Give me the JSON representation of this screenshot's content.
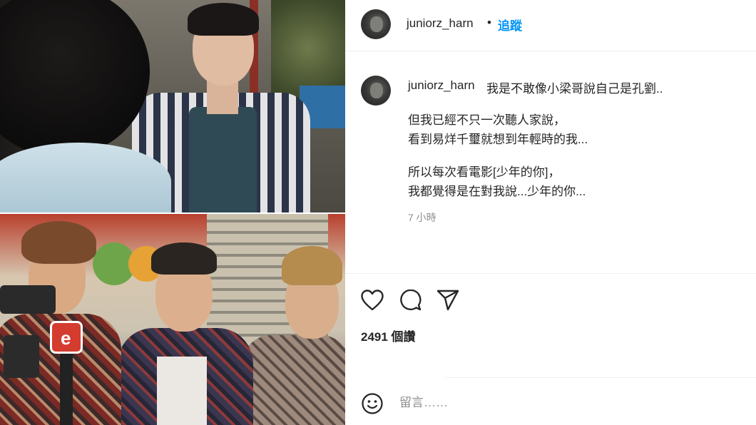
{
  "header": {
    "username": "juniorz_harn",
    "separator": "•",
    "follow_label": "追蹤"
  },
  "caption": {
    "username": "juniorz_harn",
    "lines": [
      "我是不敢像小梁哥說自己是孔劉..",
      "但我已經不只一次聽人家說，",
      "看到易烊千璽就想到年輕時的我...",
      "所以每次看電影[少年的你]，",
      "我都覺得是在對我說...少年的你..."
    ],
    "time": "7 小時"
  },
  "actions": {
    "icons": [
      "heart-icon",
      "comment-icon",
      "share-icon"
    ],
    "likes": "2491 個讚"
  },
  "comment": {
    "placeholder": "留言……",
    "icon": "emoji-icon"
  },
  "colors": {
    "follow": "#0095f6",
    "text": "#262626",
    "muted": "#8e8e8e",
    "divider": "#efefef"
  }
}
